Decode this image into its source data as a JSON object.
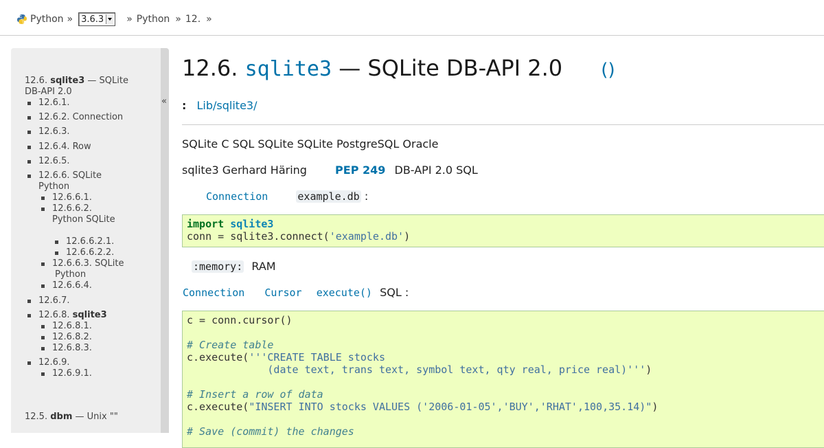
{
  "breadcrumb": {
    "python_label": "Python",
    "version": "3.6.3",
    "crumb2": "Python",
    "crumb3": "12.",
    "sep": "»"
  },
  "sidebar": {
    "collapse_label": "«",
    "toc_title_prefix": "12.6.",
    "toc_title_bold": "sqlite3",
    "toc_title_rest": "— SQLite",
    "toc_title_line2": "DB-API 2.0",
    "items": [
      {
        "text": "12.6.1."
      },
      {
        "text": "12.6.2. Connection"
      },
      {
        "text": "12.6.3."
      },
      {
        "text": "12.6.4. Row"
      },
      {
        "text": "12.6.5."
      },
      {
        "text": "12.6.6. SQLite",
        "line2": "Python"
      },
      {
        "text": "12.6.6.1."
      },
      {
        "text": "12.6.6.2.",
        "line2": "Python  SQLite"
      },
      {
        "text": "12.6.6.2.1."
      },
      {
        "text": "12.6.6.2.2."
      },
      {
        "text": "12.6.6.3. SQLite",
        "line2": "Python"
      },
      {
        "text": "12.6.6.4."
      },
      {
        "text": "12.6.7."
      },
      {
        "text": "12.6.8.",
        "bold": "sqlite3"
      },
      {
        "text": "12.6.8.1."
      },
      {
        "text": "12.6.8.2."
      },
      {
        "text": "12.6.8.3."
      },
      {
        "text": "12.6.9."
      },
      {
        "text": "12.6.9.1."
      }
    ],
    "prev_prefix": "12.5.",
    "prev_bold": "dbm",
    "prev_rest": "— Unix \"\""
  },
  "main": {
    "title_num": "12.6.",
    "title_code": "sqlite3",
    "title_rest": "— SQLite  DB-API 2.0",
    "title_paren": "()",
    "source_colon": ":",
    "source_link": "Lib/sqlite3/",
    "p1": "SQLite  C  SQL  SQLite SQLite  PostgreSQL  Oracle",
    "p2_a": "sqlite3  Gerhard Häring",
    "p2_pep": "PEP 249",
    "p2_b": "DB-API 2.0  SQL",
    "p3_code": "Connection",
    "p3_file": "example.db",
    "p3_colon": ":",
    "code1": {
      "kw": "import",
      "mod": "sqlite3",
      "line2_a": "conn = sqlite3.connect(",
      "line2_str": "'example.db'",
      "line2_b": ")"
    },
    "p4_code": ":memory:",
    "p4_text": "RAM",
    "p5_a": "Connection",
    "p5_b": "Cursor",
    "p5_c": "execute()",
    "p5_text": "SQL :",
    "code2": {
      "l1": "c = conn.cursor()",
      "l3": "# Create table",
      "l4_a": "c.execute(",
      "l4_str": "'''CREATE TABLE stocks",
      "l5_str": "             (date text, trans text, symbol text, qty real, price real)'''",
      "l5_b": ")",
      "l7": "# Insert a row of data",
      "l8_a": "c.execute(",
      "l8_str": "\"INSERT INTO stocks VALUES ('2006-01-05','BUY','RHAT',100,35.14)\"",
      "l8_b": ")",
      "l10": "# Save (commit) the changes"
    }
  }
}
